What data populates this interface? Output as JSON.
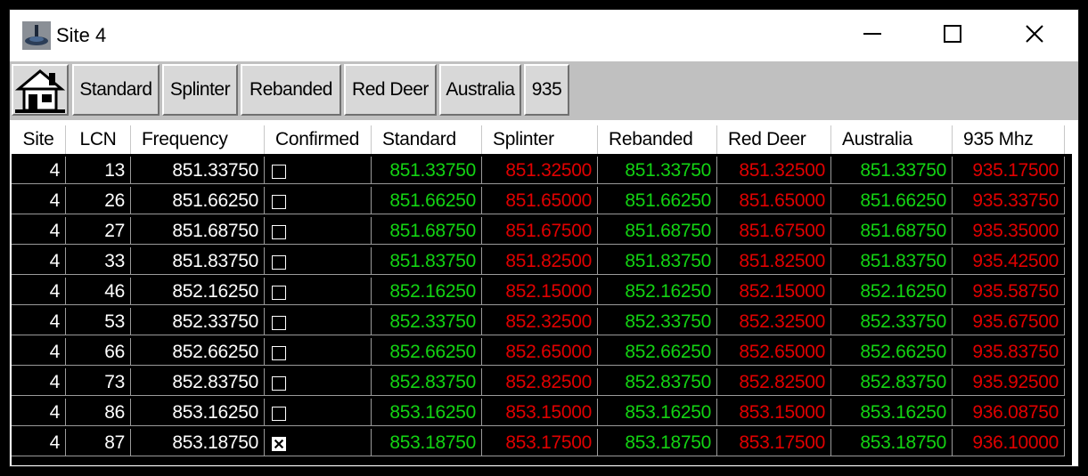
{
  "window": {
    "title": "Site 4"
  },
  "toolbar": {
    "buttons": [
      "Standard",
      "Splinter",
      "Rebanded",
      "Red Deer",
      "Australia",
      "935"
    ]
  },
  "grid": {
    "columns": [
      "Site",
      "LCN",
      "Frequency",
      "Confirmed",
      "Standard",
      "Splinter",
      "Rebanded",
      "Red Deer",
      "Australia",
      "935 Mhz"
    ],
    "rows": [
      {
        "site": "4",
        "lcn": "13",
        "frequency": "851.33750",
        "confirmed": false,
        "standard": "851.33750",
        "splinter": "851.32500",
        "rebanded": "851.33750",
        "red_deer": "851.32500",
        "australia": "851.33750",
        "mhz935": "935.17500"
      },
      {
        "site": "4",
        "lcn": "26",
        "frequency": "851.66250",
        "confirmed": false,
        "standard": "851.66250",
        "splinter": "851.65000",
        "rebanded": "851.66250",
        "red_deer": "851.65000",
        "australia": "851.66250",
        "mhz935": "935.33750"
      },
      {
        "site": "4",
        "lcn": "27",
        "frequency": "851.68750",
        "confirmed": false,
        "standard": "851.68750",
        "splinter": "851.67500",
        "rebanded": "851.68750",
        "red_deer": "851.67500",
        "australia": "851.68750",
        "mhz935": "935.35000"
      },
      {
        "site": "4",
        "lcn": "33",
        "frequency": "851.83750",
        "confirmed": false,
        "standard": "851.83750",
        "splinter": "851.82500",
        "rebanded": "851.83750",
        "red_deer": "851.82500",
        "australia": "851.83750",
        "mhz935": "935.42500"
      },
      {
        "site": "4",
        "lcn": "46",
        "frequency": "852.16250",
        "confirmed": false,
        "standard": "852.16250",
        "splinter": "852.15000",
        "rebanded": "852.16250",
        "red_deer": "852.15000",
        "australia": "852.16250",
        "mhz935": "935.58750"
      },
      {
        "site": "4",
        "lcn": "53",
        "frequency": "852.33750",
        "confirmed": false,
        "standard": "852.33750",
        "splinter": "852.32500",
        "rebanded": "852.33750",
        "red_deer": "852.32500",
        "australia": "852.33750",
        "mhz935": "935.67500"
      },
      {
        "site": "4",
        "lcn": "66",
        "frequency": "852.66250",
        "confirmed": false,
        "standard": "852.66250",
        "splinter": "852.65000",
        "rebanded": "852.66250",
        "red_deer": "852.65000",
        "australia": "852.66250",
        "mhz935": "935.83750"
      },
      {
        "site": "4",
        "lcn": "73",
        "frequency": "852.83750",
        "confirmed": false,
        "standard": "852.83750",
        "splinter": "852.82500",
        "rebanded": "852.83750",
        "red_deer": "852.82500",
        "australia": "852.83750",
        "mhz935": "935.92500"
      },
      {
        "site": "4",
        "lcn": "86",
        "frequency": "853.16250",
        "confirmed": false,
        "standard": "853.16250",
        "splinter": "853.15000",
        "rebanded": "853.16250",
        "red_deer": "853.15000",
        "australia": "853.16250",
        "mhz935": "936.08750"
      },
      {
        "site": "4",
        "lcn": "87",
        "frequency": "853.18750",
        "confirmed": true,
        "standard": "853.18750",
        "splinter": "853.17500",
        "rebanded": "853.18750",
        "red_deer": "853.17500",
        "australia": "853.18750",
        "mhz935": "936.10000"
      }
    ]
  },
  "colors": {
    "match": "#13d313",
    "mismatch": "#e00000",
    "neutral": "#ffffff",
    "grid_bg": "#000000"
  },
  "icons": {
    "app": "site-tower-icon",
    "home": "home-icon",
    "minimize": "minimize-icon",
    "maximize": "maximize-icon",
    "close": "close-icon",
    "checkbox": "checkbox-icon"
  }
}
